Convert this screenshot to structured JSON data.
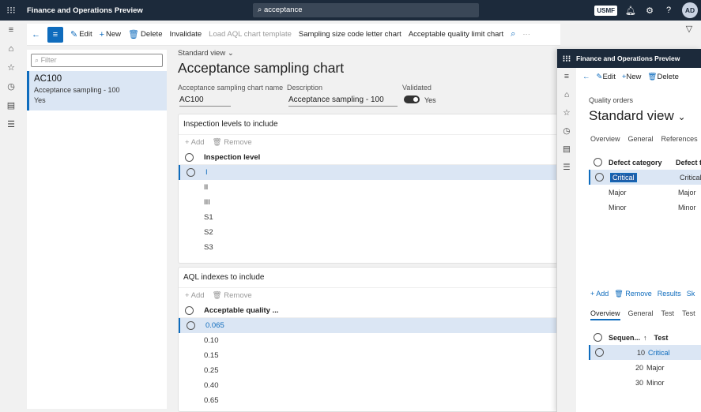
{
  "topbar": {
    "app_name": "Finance and Operations Preview",
    "search_value": "acceptance",
    "company": "USMF",
    "avatar": "AD"
  },
  "actionbar": {
    "edit": "Edit",
    "new": "New",
    "delete": "Delete",
    "invalidate": "Invalidate",
    "load_template": "Load AQL chart template",
    "sampling_size": "Sampling size code letter chart",
    "aql_chart": "Acceptable quality limit chart",
    "more": "···"
  },
  "list": {
    "filter_placeholder": "Filter",
    "items": [
      {
        "name": "AC100",
        "description": "Acceptance sampling - 100",
        "validated": "Yes"
      }
    ]
  },
  "main": {
    "view": "Standard view",
    "title": "Acceptance sampling chart",
    "fields": {
      "name_label": "Acceptance sampling chart name",
      "name_value": "AC100",
      "desc_label": "Description",
      "desc_value": "Acceptance sampling - 100",
      "validated_label": "Validated",
      "validated_value": "Yes"
    },
    "inspection": {
      "header": "Inspection levels to include",
      "add": "Add",
      "remove": "Remove",
      "column": "Inspection level",
      "rows": [
        "I",
        "II",
        "III",
        "S1",
        "S2",
        "S3"
      ]
    },
    "aql": {
      "header": "AQL indexes to include",
      "add": "Add",
      "remove": "Remove",
      "column": "Acceptable quality ...",
      "rows": [
        "0.065",
        "0.10",
        "0.15",
        "0.25",
        "0.40",
        "0.65"
      ]
    }
  },
  "right_panel": {
    "app_name": "Finance and Operations Preview",
    "edit": "Edit",
    "new": "New",
    "delete": "Delete",
    "breadcrumb": "Quality orders",
    "title": "Standard view",
    "tabs": [
      "Overview",
      "General",
      "References"
    ],
    "defect_grid": {
      "col1": "Defect category",
      "col2": "Defect t",
      "rows": [
        {
          "category": "Critical",
          "type": "Critical"
        },
        {
          "category": "Major",
          "type": "Major"
        },
        {
          "category": "Minor",
          "type": "Minor"
        }
      ]
    },
    "lines_bar": {
      "add": "Add",
      "remove": "Remove",
      "results": "Results",
      "more": "Sk"
    },
    "line_tabs": [
      "Overview",
      "General",
      "Test",
      "Test"
    ],
    "test_grid": {
      "col1": "Sequen...",
      "col2": "Test",
      "rows": [
        {
          "seq": "10",
          "test": "Critical"
        },
        {
          "seq": "20",
          "test": "Major"
        },
        {
          "seq": "30",
          "test": "Minor"
        }
      ]
    }
  }
}
